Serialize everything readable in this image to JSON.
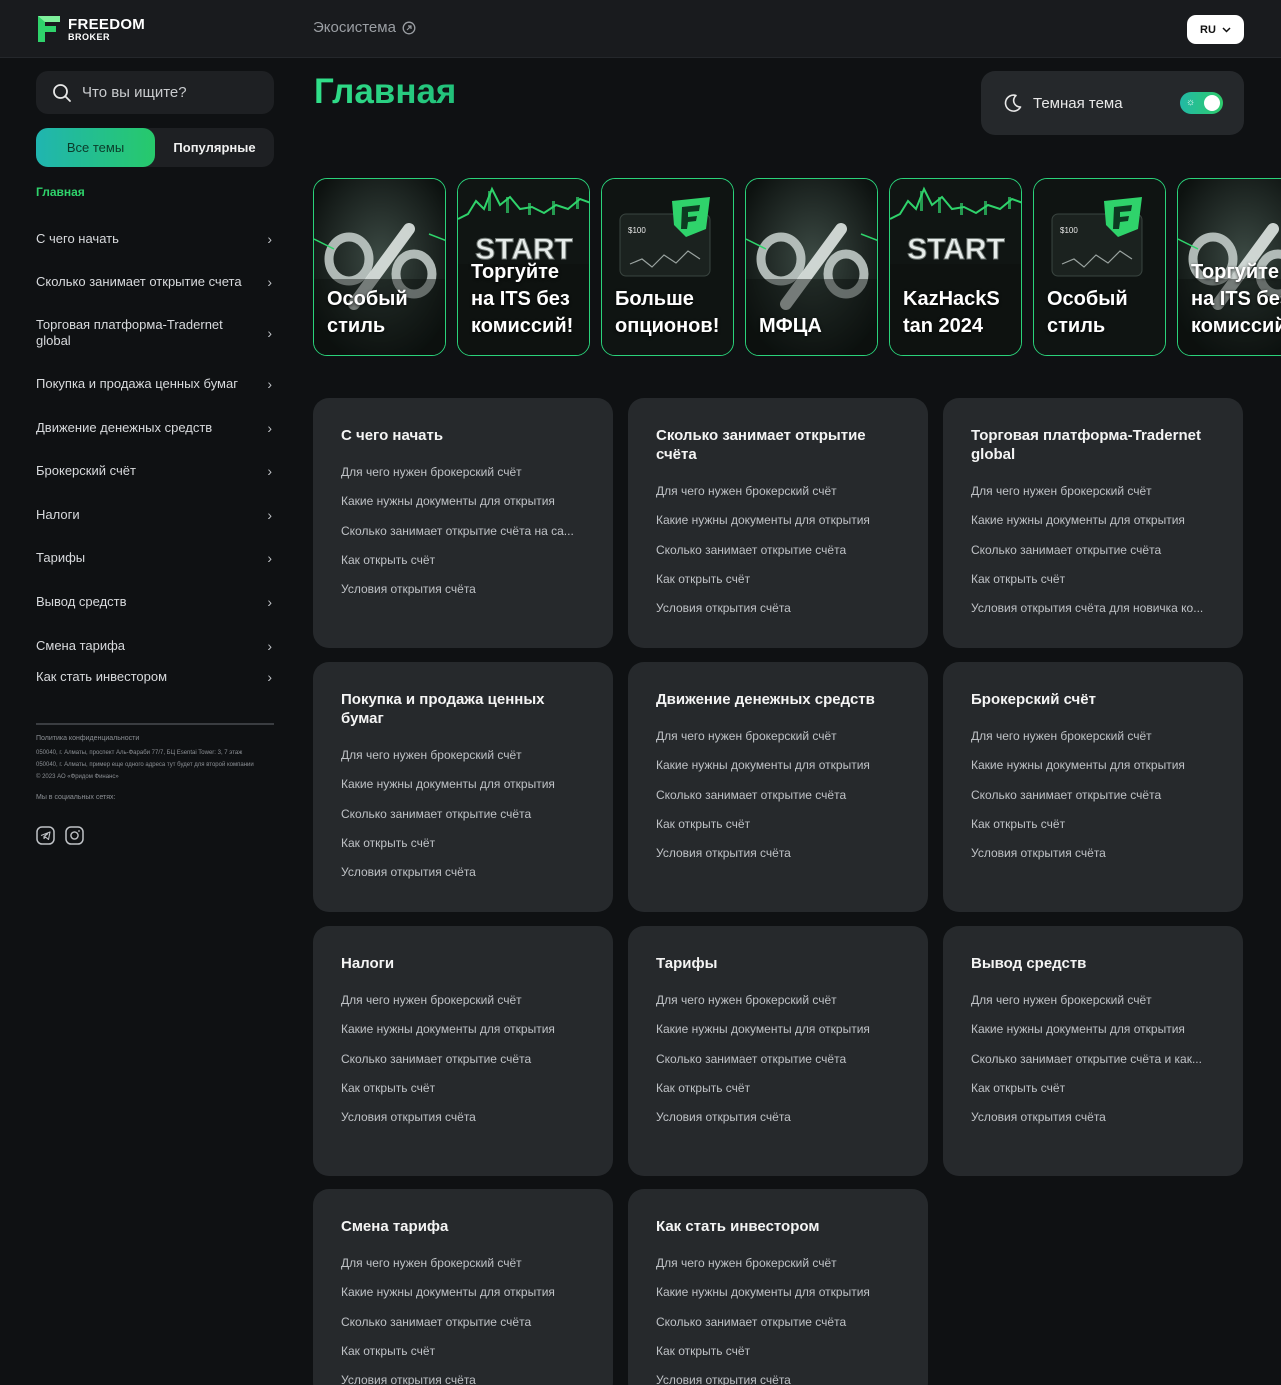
{
  "header": {
    "logo_line1": "FREEDOM",
    "logo_line2": "BROKER",
    "ecosystem_label": "Экосистема",
    "lang_label": "RU"
  },
  "sidebar": {
    "search_placeholder": "Что вы ищите?",
    "filters": [
      "Все темы",
      "Популярные"
    ],
    "items": [
      "Главная",
      "С чего начать",
      "Сколько занимает открытие счета",
      "Торговая платформа-Tradernet global",
      "Покупка и продажа ценных бумаг",
      "Движение денежных средств",
      "Брокерский счёт",
      "Налоги",
      "Тарифы",
      "Вывод средств",
      "Смена тарифа",
      "Как стать инвестором"
    ],
    "footer": {
      "privacy": "Политика конфиденциальности",
      "address1": "050040, г. Алматы, проспект Аль-Фараби 77/7, БЦ Esentai Tower: 3, 7 этаж",
      "address2": "050040, г. Алматы, пример еще одного адреса тут будет для второй компании",
      "copyright": "© 2023 АО «Фридом Финанс»",
      "socials_label": "Мы в социальных сетях:"
    }
  },
  "main": {
    "title": "Главная",
    "theme_label": "Темная тема",
    "theme_toggle_on": true
  },
  "stories": [
    {
      "caption": "Особый\nстиль",
      "art": "percent"
    },
    {
      "caption": "Торгуйте\nна ITS без\nкомиссий!",
      "art": "start"
    },
    {
      "caption": "Больше\nопционов!",
      "art": "card"
    },
    {
      "caption": "МФЦА",
      "art": "percent"
    },
    {
      "caption": "KazHackS\ntan 2024",
      "art": "start"
    },
    {
      "caption": "Особый\nстиль",
      "art": "card"
    },
    {
      "caption": "Торгуйте\nна ITS без\nкомиссий!",
      "art": "percent"
    }
  ],
  "story_art_text": {
    "start": "START",
    "card_price": "$100"
  },
  "cards": [
    {
      "title": "С чего начать",
      "links": [
        "Для чего нужен брокерский счёт",
        "Какие нужны документы для открытия",
        "Сколько занимает открытие счёта на са...",
        "Как открыть счёт",
        "Условия открытия счёта"
      ]
    },
    {
      "title": "Сколько занимает открытие счёта",
      "links": [
        "Для чего нужен брокерский счёт",
        "Какие нужны документы для открытия",
        "Сколько занимает открытие счёта",
        "Как открыть счёт",
        "Условия открытия счёта"
      ]
    },
    {
      "title": "Торговая платформа-Tradernet global",
      "links": [
        "Для чего нужен брокерский счёт",
        "Какие нужны документы для открытия",
        "Сколько занимает открытие счёта",
        "Как открыть счёт",
        "Условия открытия счёта для новичка ко..."
      ]
    },
    {
      "title": "Покупка и продажа ценных бумаг",
      "links": [
        "Для чего нужен брокерский счёт",
        "Какие нужны документы для открытия",
        "Сколько занимает открытие счёта",
        "Как открыть счёт",
        "Условия открытия счёта"
      ]
    },
    {
      "title": "Движение денежных средств",
      "links": [
        "Для чего нужен брокерский счёт",
        "Какие нужны документы для открытия",
        "Сколько занимает открытие счёта",
        "Как открыть счёт",
        "Условия открытия счёта"
      ]
    },
    {
      "title": "Брокерский счёт",
      "links": [
        "Для чего нужен брокерский счёт",
        "Какие нужны документы для открытия",
        "Сколько занимает открытие счёта",
        "Как открыть счёт",
        "Условия открытия счёта"
      ]
    },
    {
      "title": "Налоги",
      "links": [
        "Для чего нужен брокерский счёт",
        "Какие нужны документы для открытия",
        "Сколько занимает открытие счёта",
        "Как открыть счёт",
        "Условия открытия счёта"
      ]
    },
    {
      "title": "Тарифы",
      "links": [
        "Для чего нужен брокерский счёт",
        "Какие нужны документы для открытия",
        "Сколько занимает открытие счёта",
        "Как открыть счёт",
        "Условия открытия счёта"
      ]
    },
    {
      "title": "Вывод средств",
      "links": [
        "Для чего нужен брокерский счёт",
        "Какие нужны документы для открытия",
        "Сколько занимает открытие счёта и как...",
        "Как открыть счёт",
        "Условия открытия счёта"
      ]
    },
    {
      "title": "Смена тарифа",
      "links": [
        "Для чего нужен брокерский счёт",
        "Какие нужны документы для открытия",
        "Сколько занимает открытие счёта",
        "Как открыть счёт",
        "Условия открытия счёта"
      ]
    },
    {
      "title": "Как стать инвестором",
      "links": [
        "Для чего нужен брокерский счёт",
        "Какие нужны документы для открытия",
        "Сколько занимает открытие счёта",
        "Как открыть счёт",
        "Условия открытия счёта"
      ]
    }
  ],
  "colors": {
    "accent": "#2fd36b",
    "card_bg": "#26292c",
    "page_bg": "#0f1113"
  }
}
